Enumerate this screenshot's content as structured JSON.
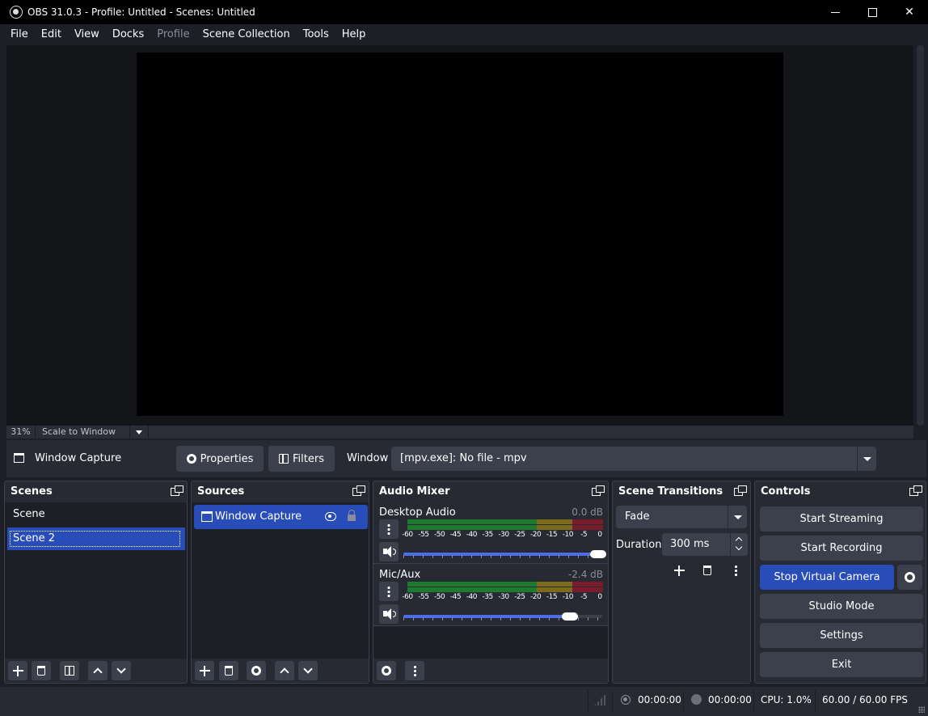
{
  "window": {
    "title": "OBS 31.0.3 - Profile: Untitled - Scenes: Untitled"
  },
  "menu": [
    {
      "label": "File",
      "enabled": true
    },
    {
      "label": "Edit",
      "enabled": true
    },
    {
      "label": "View",
      "enabled": true
    },
    {
      "label": "Docks",
      "enabled": true
    },
    {
      "label": "Profile",
      "enabled": false
    },
    {
      "label": "Scene Collection",
      "enabled": true
    },
    {
      "label": "Tools",
      "enabled": true
    },
    {
      "label": "Help",
      "enabled": true
    }
  ],
  "preview": {
    "zoom": "31%",
    "scale_mode": "Scale to Window"
  },
  "context_bar": {
    "source_name": "Window Capture",
    "properties_label": "Properties",
    "filters_label": "Filters",
    "window_label": "Window",
    "window_value": "[mpv.exe]: No file - mpv"
  },
  "docks": {
    "scenes": {
      "title": "Scenes",
      "items": [
        "Scene",
        "Scene 2"
      ],
      "selected_index": 1
    },
    "sources": {
      "title": "Sources",
      "items": [
        {
          "name": "Window Capture",
          "visible": true,
          "locked": false
        }
      ]
    },
    "audio_mixer": {
      "title": "Audio Mixer",
      "channels": [
        {
          "name": "Desktop Audio",
          "db": "0.0 dB",
          "volume": 1.0
        },
        {
          "name": "Mic/Aux",
          "db": "-2.4 dB",
          "volume": 0.85
        }
      ],
      "ticks": [
        "-60",
        "-55",
        "-50",
        "-45",
        "-40",
        "-35",
        "-30",
        "-25",
        "-20",
        "-15",
        "-10",
        "-5",
        "0"
      ]
    },
    "scene_transitions": {
      "title": "Scene Transitions",
      "transition": "Fade",
      "duration_label": "Duration",
      "duration_value": "300 ms"
    },
    "controls": {
      "title": "Controls",
      "start_streaming": "Start Streaming",
      "start_recording": "Start Recording",
      "stop_virtual_camera": "Stop Virtual Camera",
      "studio_mode": "Studio Mode",
      "settings": "Settings",
      "exit": "Exit"
    }
  },
  "status": {
    "stream_time": "00:00:00",
    "record_time": "00:00:00",
    "cpu": "CPU: 1.0%",
    "fps": "60.00 / 60.00 FPS"
  },
  "colors": {
    "accent": "#284cb8",
    "background": "#1d1f26",
    "panel": "#272a33",
    "button": "#3c404d"
  }
}
